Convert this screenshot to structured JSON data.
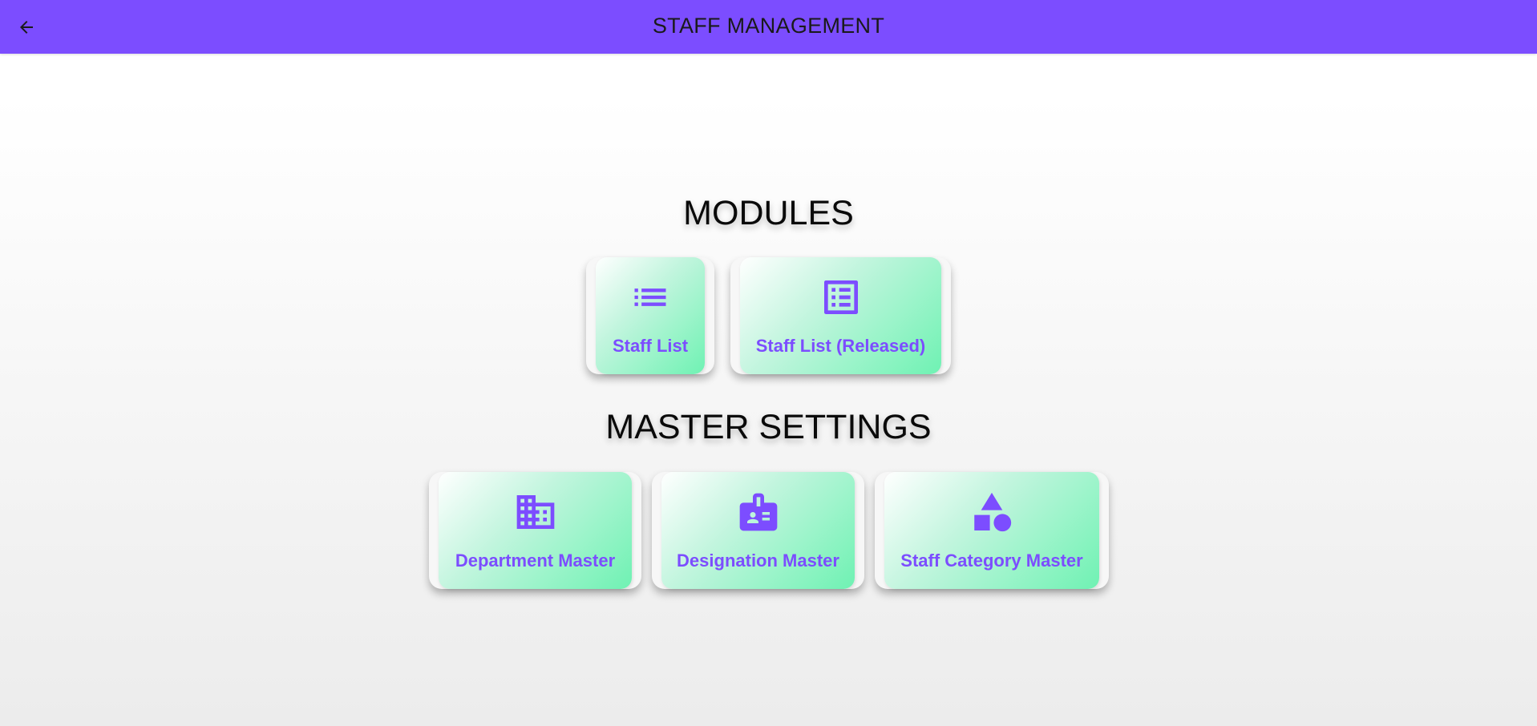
{
  "appbar": {
    "title": "STAFF MANAGEMENT",
    "back_icon": "arrow-left-icon",
    "color": "#7c4dff"
  },
  "modules": {
    "title": "MODULES",
    "items": [
      {
        "label": "Staff List",
        "icon": "list-icon"
      },
      {
        "label": "Staff List (Released)",
        "icon": "list-alt-icon"
      }
    ]
  },
  "master_settings": {
    "title": "MASTER SETTINGS",
    "items": [
      {
        "label": "Department Master",
        "icon": "building-icon"
      },
      {
        "label": "Designation Master",
        "icon": "badge-icon"
      },
      {
        "label": "Staff Category Master",
        "icon": "category-icon"
      }
    ]
  },
  "colors": {
    "accent": "#7c4dff",
    "card_gradient_start": "#ffffff",
    "card_gradient_end": "#6ff2b3"
  }
}
